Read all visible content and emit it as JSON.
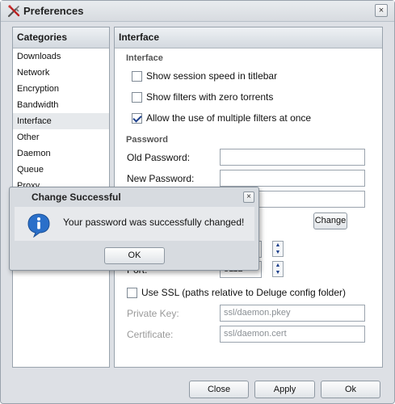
{
  "window": {
    "title": "Preferences",
    "close_glyph": "×"
  },
  "categories": {
    "header": "Categories",
    "items": [
      {
        "label": "Downloads"
      },
      {
        "label": "Network"
      },
      {
        "label": "Encryption"
      },
      {
        "label": "Bandwidth"
      },
      {
        "label": "Interface",
        "selected": true
      },
      {
        "label": "Other"
      },
      {
        "label": "Daemon"
      },
      {
        "label": "Queue"
      },
      {
        "label": "Proxy"
      }
    ]
  },
  "interface": {
    "header": "Interface",
    "section_interface": "Interface",
    "checkboxes": [
      {
        "label": "Show session speed in titlebar",
        "checked": false
      },
      {
        "label": "Show filters with zero torrents",
        "checked": false
      },
      {
        "label": "Allow the use of multiple filters at once",
        "checked": true
      }
    ],
    "section_password": "Password",
    "old_password_label": "Old Password:",
    "new_password_label": "New Password:",
    "change_button": "Change",
    "port_label": "Port:",
    "port_value": "8112",
    "use_ssl_label": "Use SSL (paths relative to Deluge config folder)",
    "use_ssl_checked": false,
    "private_key_label": "Private Key:",
    "private_key_value": "ssl/daemon.pkey",
    "certificate_label": "Certificate:",
    "certificate_value": "ssl/daemon.cert"
  },
  "modal": {
    "title": "Change Successful",
    "message": "Your password was successfully changed!",
    "ok_button": "OK",
    "close_glyph": "×"
  },
  "footer": {
    "close_button": "Close",
    "apply_button": "Apply",
    "ok_button": "Ok"
  },
  "colors": {
    "window_bg": "#dde0e5",
    "panel_border": "#99a3ad",
    "checkbox_check": "#1d3f8c",
    "info_icon": "#2a6fc9"
  }
}
